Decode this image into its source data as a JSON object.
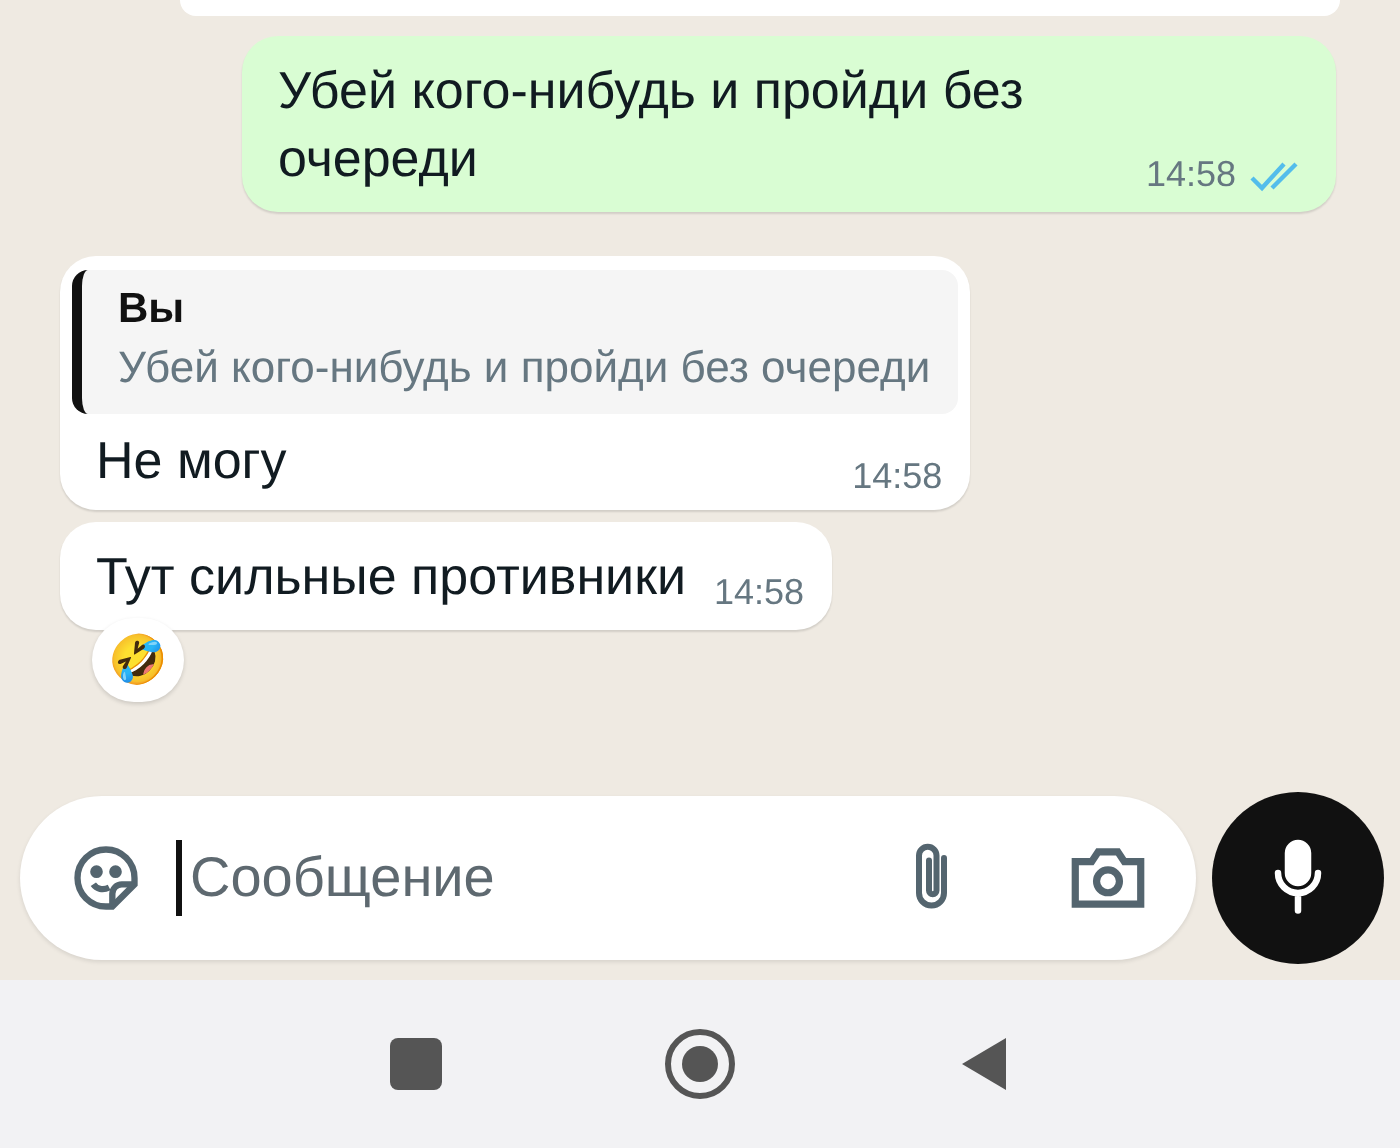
{
  "messages": [
    {
      "kind": "outgoing",
      "text": "Убей кого-нибудь и пройди без очереди",
      "time": "14:58",
      "read": true
    },
    {
      "kind": "incoming",
      "quote": {
        "author": "Вы",
        "text": "Убей кого-нибудь и пройди без очереди"
      },
      "text": "Не могу",
      "time": "14:58"
    },
    {
      "kind": "incoming",
      "text": "Тут сильные противники",
      "time": "14:58",
      "reaction": "🤣"
    }
  ],
  "composer": {
    "placeholder": "Сообщение"
  }
}
